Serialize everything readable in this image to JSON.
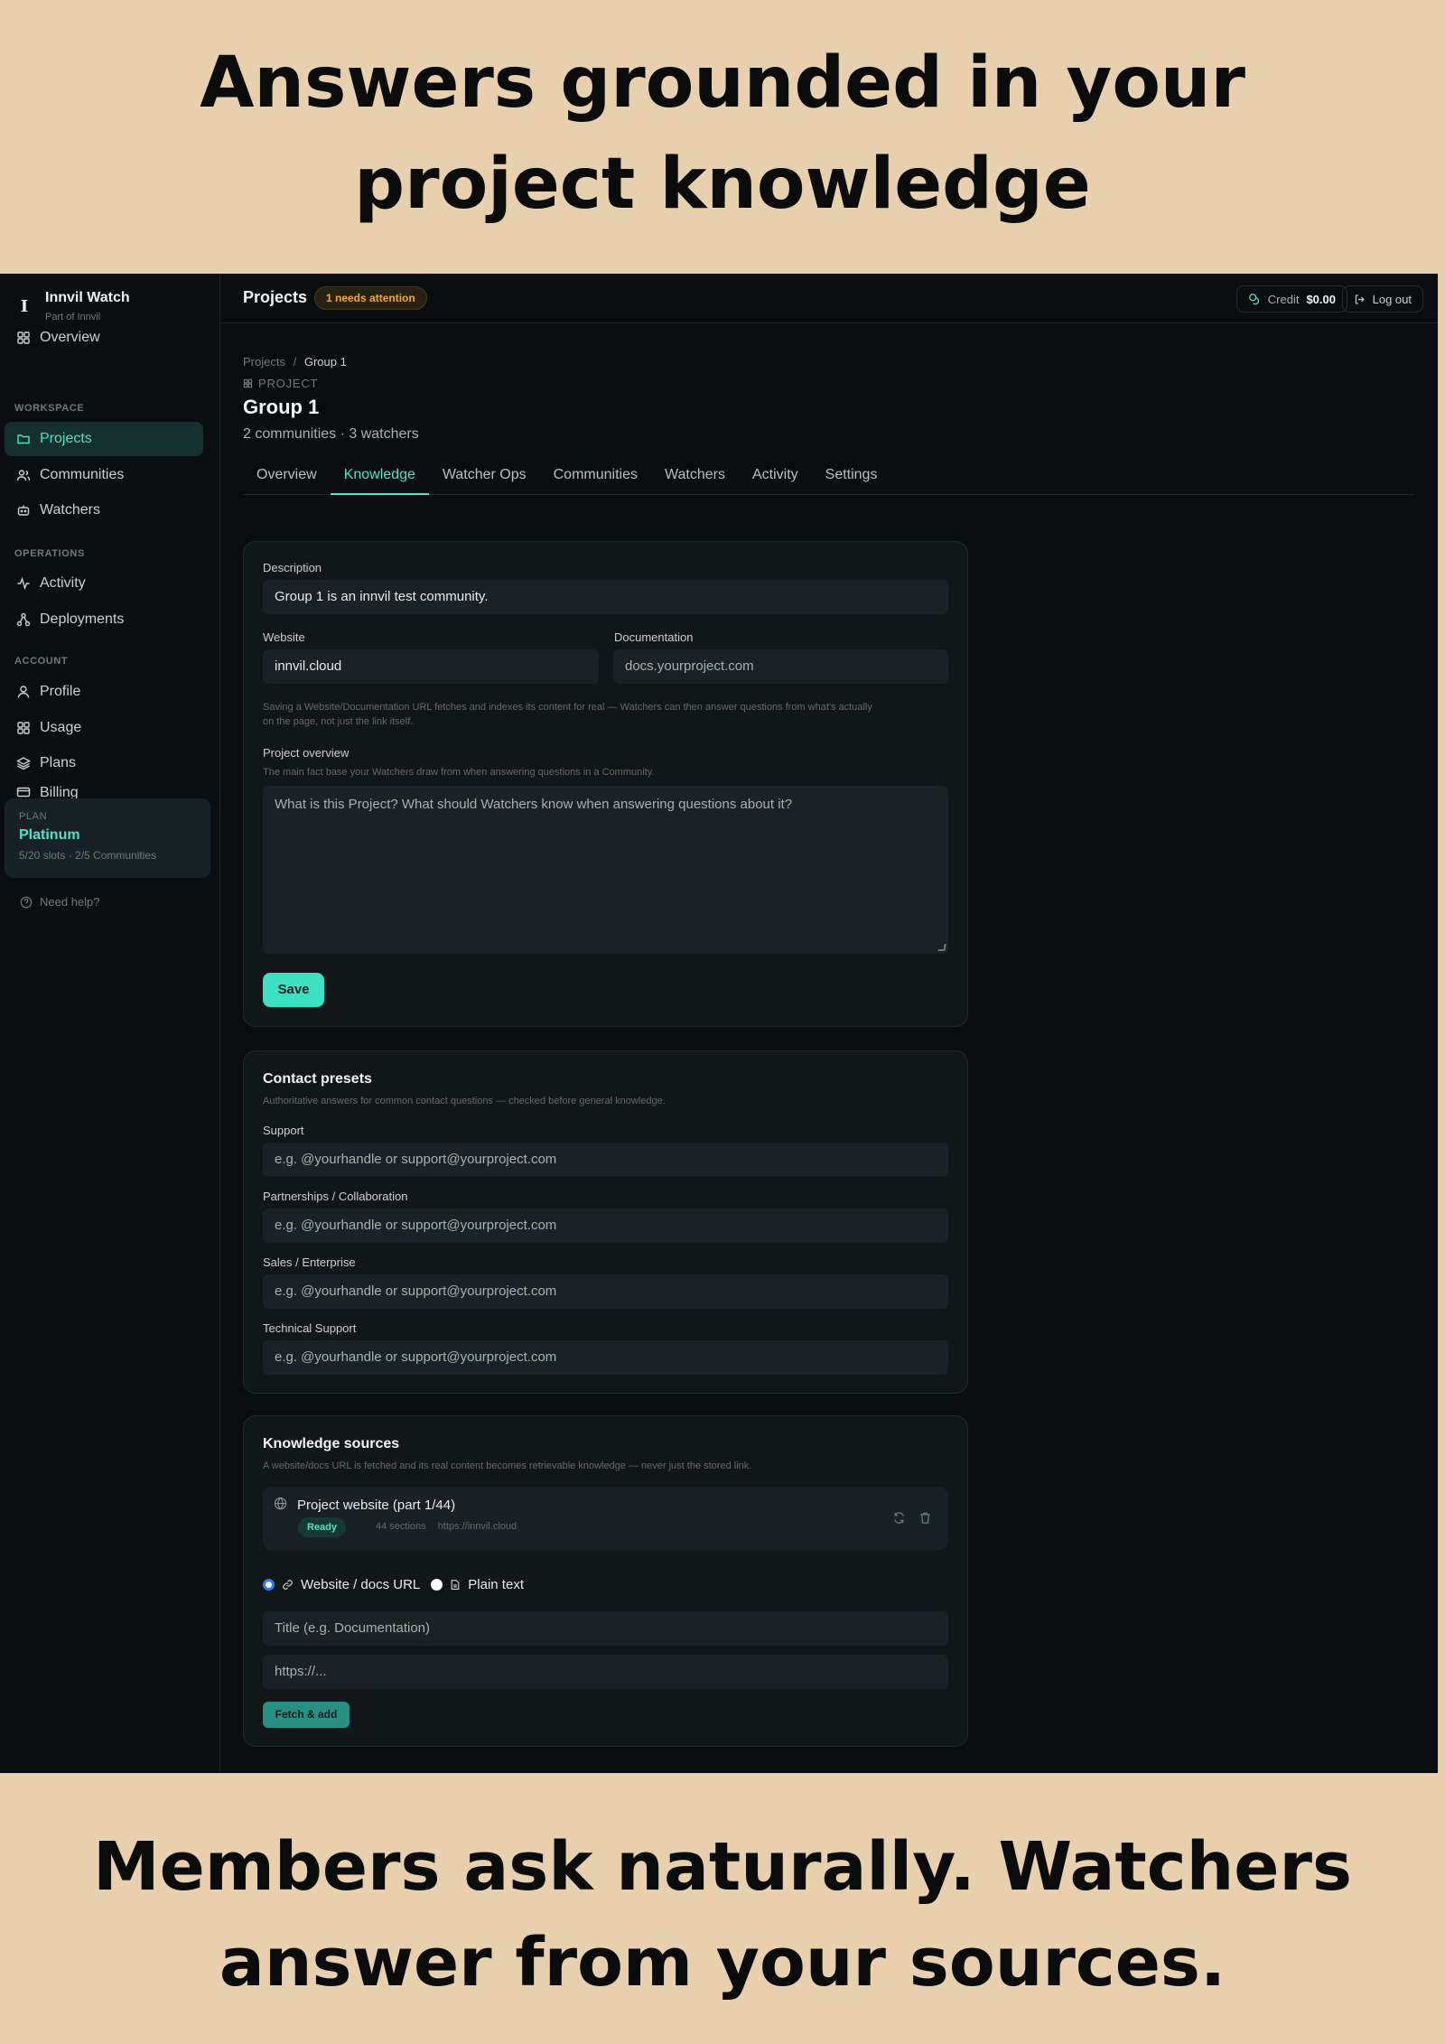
{
  "headline_top": "Answers grounded in your project knowledge",
  "headline_bottom": "Members ask naturally. Watchers answer from your sources.",
  "app": {
    "name": "Innvil Watch",
    "subtitle": "Part of Innvil"
  },
  "sidebar": {
    "overview": "Overview",
    "sections": {
      "workspace": "WORKSPACE",
      "operations": "OPERATIONS",
      "account": "ACCOUNT"
    },
    "workspace_items": [
      "Projects",
      "Communities",
      "Watchers"
    ],
    "operations_items": [
      "Activity",
      "Deployments"
    ],
    "account_items": [
      "Profile",
      "Usage",
      "Plans",
      "Billing"
    ],
    "active_item": "Projects",
    "plan": {
      "label": "PLAN",
      "name": "Platinum",
      "meta": "5/20 slots · 2/5 Communities"
    },
    "help": "Need help?"
  },
  "topbar": {
    "title": "Projects",
    "attention_badge": "1 needs attention",
    "credit_label": "Credit",
    "credit_value": "$0.00",
    "logout": "Log out"
  },
  "breadcrumb": {
    "root": "Projects",
    "sep": "/",
    "current": "Group 1"
  },
  "project": {
    "label": "PROJECT",
    "title": "Group 1",
    "meta": "2 communities · 3 watchers"
  },
  "tabs": [
    "Overview",
    "Knowledge",
    "Watcher Ops",
    "Communities",
    "Watchers",
    "Activity",
    "Settings"
  ],
  "active_tab": "Knowledge",
  "description_card": {
    "description_label": "Description",
    "description_value": "Group 1 is an innvil test community.",
    "website_label": "Website",
    "website_value": "innvil.cloud",
    "docs_label": "Documentation",
    "docs_placeholder": "docs.yourproject.com",
    "fetch_hint_1": "Saving a Website/Documentation URL fetches and indexes its content for real — Watchers can then answer questions from what's actually",
    "fetch_hint_2": "on the page, not just the link itself.",
    "overview_label": "Project overview",
    "overview_hint": "The main fact base your Watchers draw from when answering questions in a Community.",
    "overview_placeholder": "What is this Project? What should Watchers know when answering questions about it?",
    "save": "Save"
  },
  "contact_card": {
    "title": "Contact presets",
    "hint": "Authoritative answers for common contact questions — checked before general knowledge.",
    "fields": [
      {
        "label": "Support",
        "placeholder": "e.g. @yourhandle or support@yourproject.com"
      },
      {
        "label": "Partnerships / Collaboration",
        "placeholder": "e.g. @yourhandle or support@yourproject.com"
      },
      {
        "label": "Sales / Enterprise",
        "placeholder": "e.g. @yourhandle or support@yourproject.com"
      },
      {
        "label": "Technical Support",
        "placeholder": "e.g. @yourhandle or support@yourproject.com"
      }
    ]
  },
  "sources_card": {
    "title": "Knowledge sources",
    "hint": "A website/docs URL is fetched and its real content becomes retrievable knowledge — never just the stored link.",
    "item": {
      "title": "Project website (part 1/44)",
      "status": "Ready",
      "sections": "44 sections",
      "url": "https://innvil.cloud"
    },
    "radio_url": "Website / docs URL",
    "radio_text": "Plain text",
    "title_placeholder": "Title (e.g. Documentation)",
    "url_placeholder": "https://...",
    "fetch": "Fetch & add"
  },
  "colors": {
    "accent": "#4fe3c7",
    "background": "#e8d0ae",
    "app_bg": "#0a0d0f",
    "warning": "#f0a92c"
  }
}
